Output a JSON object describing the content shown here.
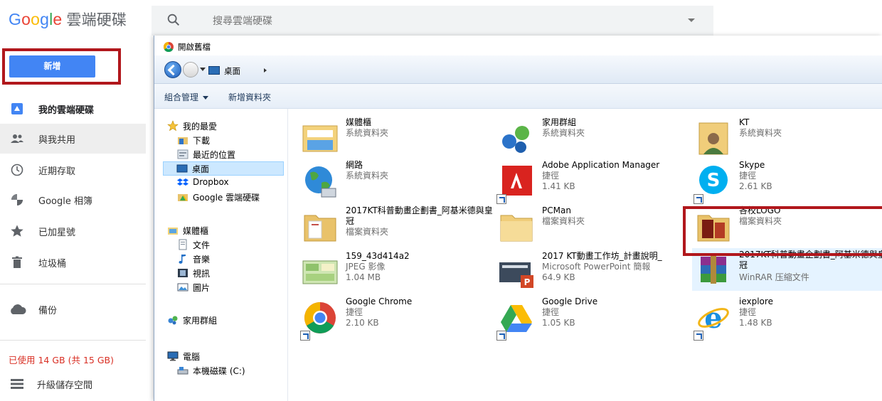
{
  "drive": {
    "logo_text": "Google",
    "product_name": "雲端硬碟",
    "search_placeholder": "搜尋雲端硬碟",
    "new_button": "新增",
    "nav": [
      {
        "label": "我的雲端硬碟",
        "icon": "my-drive-icon"
      },
      {
        "label": "與我共用",
        "icon": "shared-with-me-icon"
      },
      {
        "label": "近期存取",
        "icon": "recent-clock-icon"
      },
      {
        "label": "Google 相簿",
        "icon": "google-photos-icon"
      },
      {
        "label": "已加星號",
        "icon": "star-icon"
      },
      {
        "label": "垃圾桶",
        "icon": "trash-icon"
      },
      {
        "label": "備份",
        "icon": "cloud-icon"
      },
      {
        "label": "升級儲存空間",
        "icon": "storage-bars-icon"
      }
    ],
    "storage_text": "已使用 14 GB (共 15 GB)"
  },
  "dialog": {
    "title": "開啟舊檔",
    "address_location": "桌面",
    "toolbar": {
      "organize": "組合管理",
      "new_folder": "新增資料夾"
    },
    "nav_pane": {
      "favorites_header": "我的最愛",
      "favorites": [
        "下載",
        "最近的位置",
        "桌面",
        "Dropbox",
        "Google 雲端硬碟"
      ],
      "libraries_header": "媒體櫃",
      "libraries": [
        "文件",
        "音樂",
        "視訊",
        "圖片"
      ],
      "homegroup": "家用群組",
      "computer_header": "電腦",
      "computer": [
        "本機磁碟 (C:)"
      ]
    },
    "items": [
      {
        "name": "媒體櫃",
        "type": "系統資料夾",
        "size": "",
        "icon": "libraries-folder-icon"
      },
      {
        "name": "家用群組",
        "type": "系統資料夾",
        "size": "",
        "icon": "homegroup-icon"
      },
      {
        "name": "KT",
        "type": "系統資料夾",
        "size": "",
        "icon": "user-folder-icon"
      },
      {
        "name": "網路",
        "type": "系統資料夾",
        "size": "",
        "icon": "network-globe-icon"
      },
      {
        "name": "Adobe Application Manager",
        "type": "捷徑",
        "size": "1.41 KB",
        "icon": "adobe-icon"
      },
      {
        "name": "Skype",
        "type": "捷徑",
        "size": "2.61 KB",
        "icon": "skype-icon"
      },
      {
        "name": "2017KT科普動畫企劃書_阿基米德與皇冠",
        "type": "檔案資料夾",
        "size": "",
        "icon": "folder-icon"
      },
      {
        "name": "PCMan",
        "type": "檔案資料夾",
        "size": "",
        "icon": "folder-icon"
      },
      {
        "name": "各校LOGO",
        "type": "檔案資料夾",
        "size": "",
        "icon": "folder-icon"
      },
      {
        "name": "159_43d414a2",
        "type": "JPEG 影像",
        "size": "1.04 MB",
        "icon": "jpeg-thumbnail-icon"
      },
      {
        "name": "2017 KT動畫工作坊_計畫說明_",
        "type": "Microsoft PowerPoint 簡報",
        "size": "64.9 KB",
        "icon": "powerpoint-icon"
      },
      {
        "name": "2017KT科普動畫企劃書_阿基米德與皇冠",
        "type": "WinRAR 压縮文件",
        "size": "",
        "icon": "winrar-icon"
      },
      {
        "name": "Google Chrome",
        "type": "捷徑",
        "size": "2.10 KB",
        "icon": "chrome-icon"
      },
      {
        "name": "Google Drive",
        "type": "捷徑",
        "size": "1.05 KB",
        "icon": "google-drive-icon"
      },
      {
        "name": "iexplore",
        "type": "捷徑",
        "size": "1.48 KB",
        "icon": "internet-explorer-icon"
      }
    ],
    "colors": {
      "highlight_red": "#b1171c",
      "drive_blue": "#4285f4",
      "selection_blue": "#cce8ff"
    }
  }
}
